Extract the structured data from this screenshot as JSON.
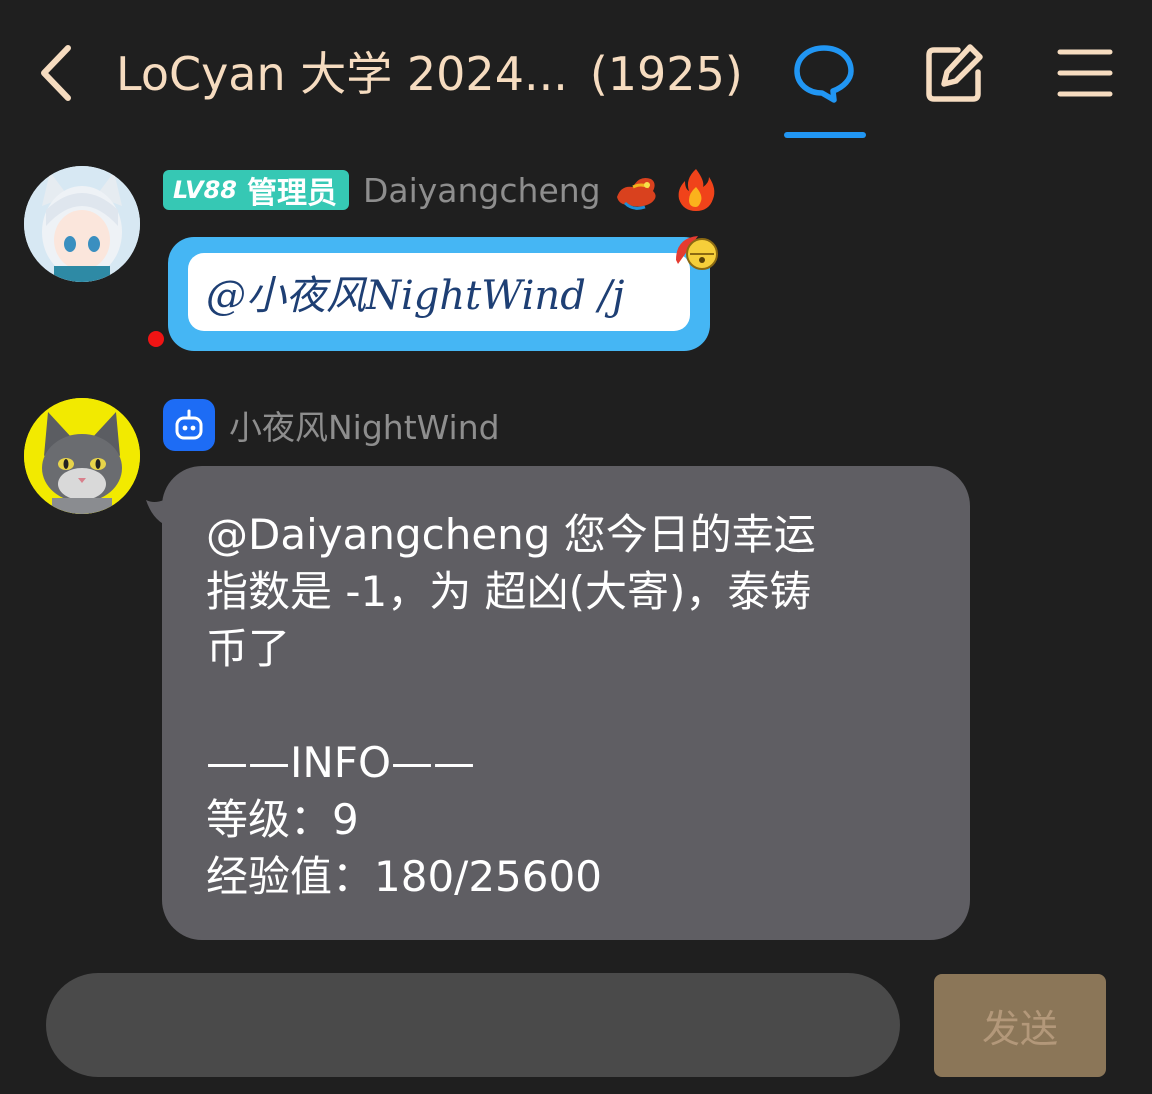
{
  "header": {
    "title": "LoCyan 大学 2024...",
    "member_count": "(1925)",
    "icons": [
      "back-arrow-icon",
      "chat-bubble-icon",
      "edit-icon",
      "menu-icon"
    ],
    "accent_color": "#2196f3"
  },
  "messages": [
    {
      "level": "LV88",
      "role": "管理员",
      "sender": "Daiyangcheng",
      "badges": [
        "dragon-icon",
        "fire-icon"
      ],
      "text": "@小夜风NightWind /j",
      "bubble_color": "#45b6f4"
    },
    {
      "sender": "小夜风NightWind",
      "is_bot": true,
      "lines": [
        "@Daiyangcheng 您今日的幸运",
        "指数是 -1，为 超凶(大寄)，泰铸",
        "币了",
        "",
        "——INFO——",
        "等级：9",
        "经验值：180/25600"
      ],
      "bubble_color": "#5f5e63"
    }
  ],
  "composer": {
    "placeholder": "",
    "send_label": "发送"
  }
}
